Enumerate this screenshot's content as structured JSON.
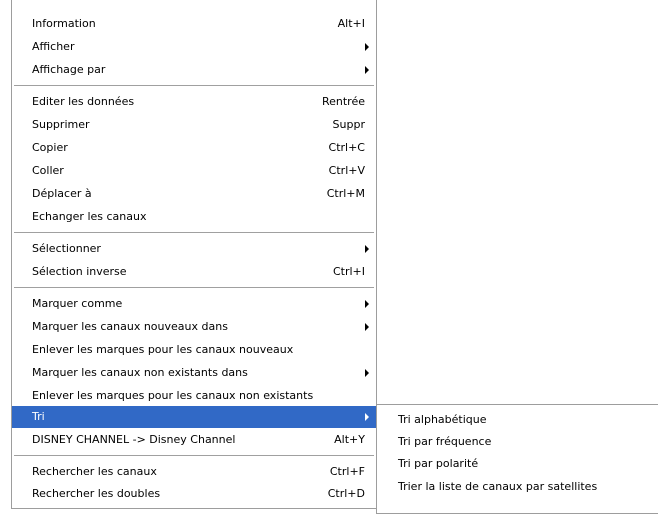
{
  "main_menu": {
    "items": [
      {
        "label": "Information",
        "accel": "Alt+I"
      },
      {
        "label": "Afficher"
      },
      {
        "label": "Affichage par"
      },
      {
        "label": "Editer les données",
        "accel": "Rentrée"
      },
      {
        "label": "Supprimer",
        "accel": "Suppr"
      },
      {
        "label": "Copier",
        "accel": "Ctrl+C"
      },
      {
        "label": "Coller",
        "accel": "Ctrl+V"
      },
      {
        "label": "Déplacer à",
        "accel": "Ctrl+M"
      },
      {
        "label": "Echanger les canaux"
      },
      {
        "label": "Sélectionner"
      },
      {
        "label": "Sélection inverse",
        "accel": "Ctrl+I"
      },
      {
        "label": "Marquer comme"
      },
      {
        "label": "Marquer les canaux nouveaux dans"
      },
      {
        "label": "Enlever les marques pour les canaux nouveaux"
      },
      {
        "label": "Marquer les canaux non existants dans"
      },
      {
        "label": "Enlever les marques pour les canaux non existants"
      },
      {
        "label": "Tri"
      },
      {
        "label": "DISNEY CHANNEL -> Disney Channel",
        "accel": "Alt+Y"
      },
      {
        "label": "Rechercher les canaux",
        "accel": "Ctrl+F"
      },
      {
        "label": "Rechercher les doubles",
        "accel": "Ctrl+D"
      }
    ]
  },
  "sub_menu": {
    "items": [
      {
        "label": "Tri alphabétique"
      },
      {
        "label": "Tri par fréquence"
      },
      {
        "label": "Tri par polarité"
      },
      {
        "label": "Trier la liste de canaux par satellites"
      }
    ]
  },
  "colors": {
    "highlight": "#3169c6",
    "border": "#9d9d9d"
  }
}
